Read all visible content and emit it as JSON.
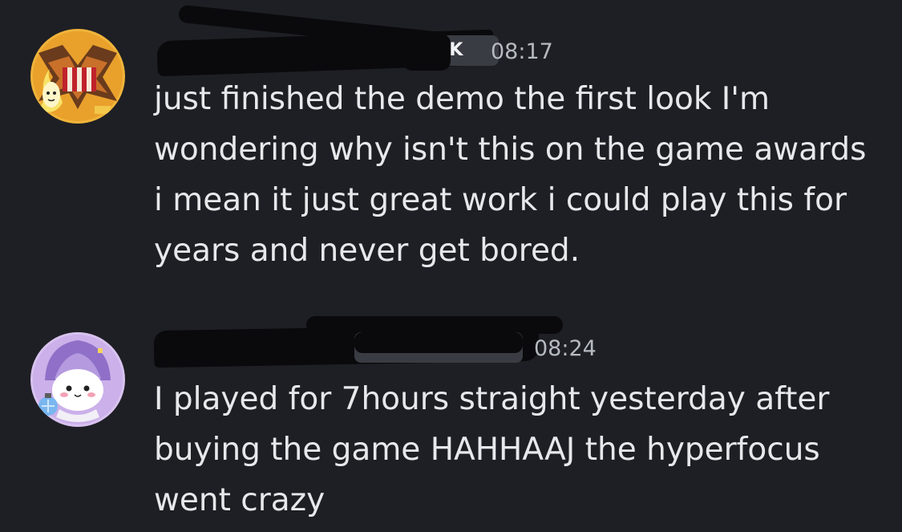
{
  "messages": [
    {
      "author": {
        "name_redacted": true,
        "tag_text": "NK",
        "avatar_icon": "yugioh-banana-avatar-icon"
      },
      "timestamp": "08:17",
      "content": "just finished the demo the first look I'm wondering why isn't this on the game awards i mean it just great work i could play this for years and never get bored."
    },
    {
      "author": {
        "name_redacted": true,
        "tag_text": "",
        "avatar_icon": "chiikawa-wizard-avatar-icon"
      },
      "timestamp": "08:24",
      "content": "I played for 7hours straight yesterday after buying the game HAHHAAJ the hyperfocus went crazy"
    }
  ],
  "colors": {
    "background": "#1e1f24",
    "message_text": "#e6e8eb",
    "timestamp_text": "#b5bac1",
    "tag_background": "#3a3c43"
  }
}
